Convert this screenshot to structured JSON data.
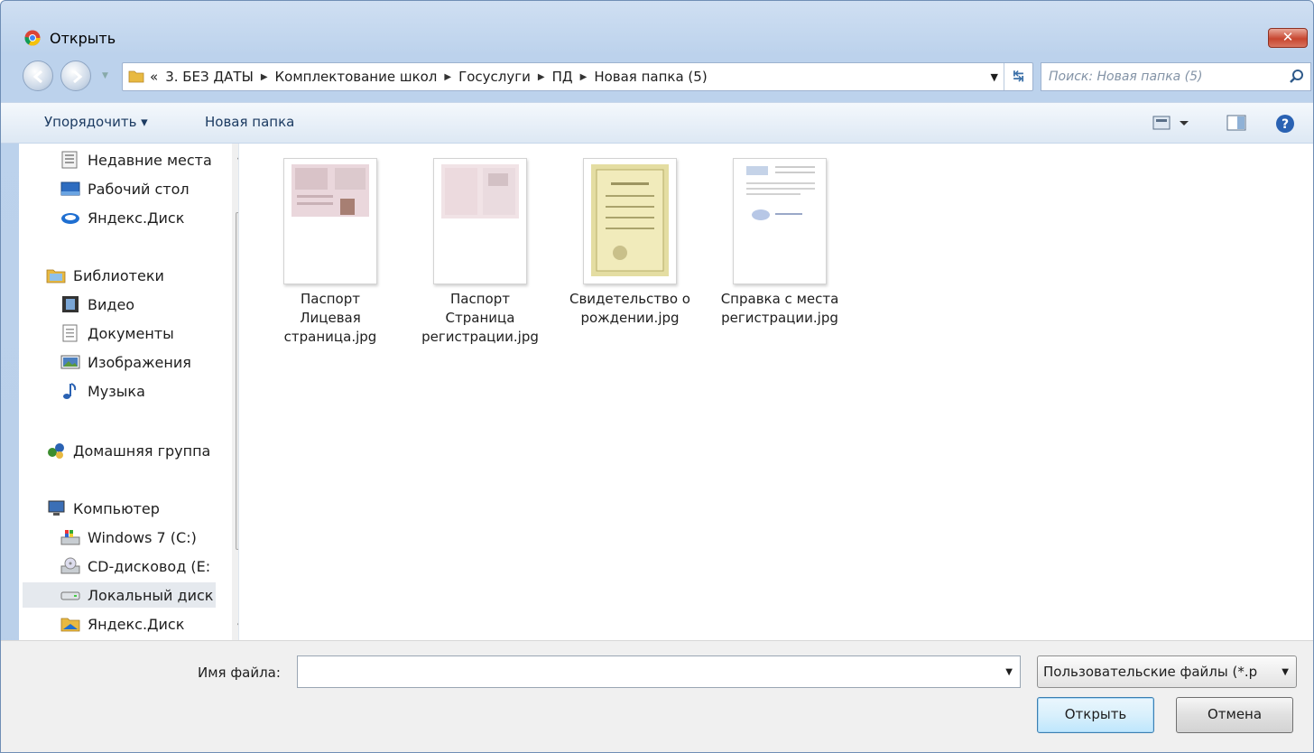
{
  "window": {
    "title": "Открыть",
    "close_label": "✕"
  },
  "address": {
    "crumbs": [
      "«",
      "3. БЕЗ ДАТЫ",
      "Комплектование школ",
      "Госуслуги",
      "ПД",
      "Новая папка (5)"
    ],
    "search_placeholder": "Поиск: Новая папка (5)"
  },
  "toolbar": {
    "organize_label": "Упорядочить ▾",
    "new_folder_label": "Новая папка"
  },
  "nav": {
    "items": [
      {
        "label": "Недавние места",
        "icon": "recent-places-icon"
      },
      {
        "label": "Рабочий стол",
        "icon": "desktop-icon"
      },
      {
        "label": "Яндекс.Диск",
        "icon": "yandex-disk-icon"
      },
      {
        "label": "Библиотеки",
        "icon": "libraries-icon"
      },
      {
        "label": "Видео",
        "icon": "video-icon"
      },
      {
        "label": "Документы",
        "icon": "documents-icon"
      },
      {
        "label": "Изображения",
        "icon": "pictures-icon"
      },
      {
        "label": "Музыка",
        "icon": "music-icon"
      },
      {
        "label": "Домашняя группа",
        "icon": "homegroup-icon"
      },
      {
        "label": "Компьютер",
        "icon": "computer-icon"
      },
      {
        "label": "Windows 7 (C:)",
        "icon": "drive-c-icon"
      },
      {
        "label": "CD-дисковод (E:",
        "icon": "cd-drive-icon"
      },
      {
        "label": "Локальный диск",
        "icon": "local-disk-icon"
      },
      {
        "label": "Яндекс.Диск",
        "icon": "yandex-folder-icon"
      }
    ]
  },
  "files": [
    {
      "line1": "Паспорт",
      "line2": "Лицевая",
      "line3": "страница.jpg"
    },
    {
      "line1": "Паспорт",
      "line2": "Страница",
      "line3": "регистрации.jpg"
    },
    {
      "line1": "Свидетельство о",
      "line2": "рождении.jpg",
      "line3": ""
    },
    {
      "line1": "Справка с места",
      "line2": "регистрации.jpg",
      "line3": ""
    }
  ],
  "bottom": {
    "filename_label": "Имя файла:",
    "filename_value": "",
    "filter_label": "Пользовательские файлы (*.p",
    "open_label": "Открыть",
    "cancel_label": "Отмена"
  }
}
